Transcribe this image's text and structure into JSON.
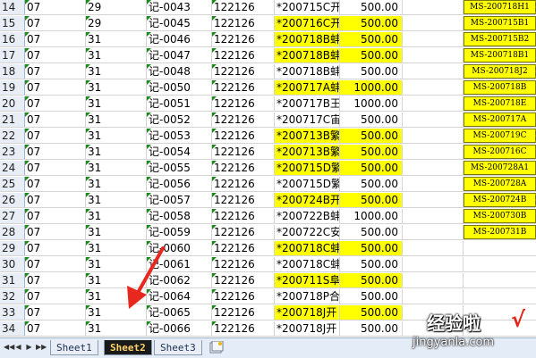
{
  "rows": [
    {
      "n": "14",
      "a": "07",
      "b": "29",
      "c": "记-0043",
      "d": "122126",
      "e": "*200715C开",
      "f": "500.00",
      "hl": false,
      "ms": "MS-200718H1"
    },
    {
      "n": "15",
      "a": "07",
      "b": "29",
      "c": "记-0045",
      "d": "122126",
      "e": "*200716C开",
      "f": "500.00",
      "hl": true,
      "ms": "MS-200715B1"
    },
    {
      "n": "16",
      "a": "07",
      "b": "31",
      "c": "记-0046",
      "d": "122126",
      "e": "*200718B蚌",
      "f": "500.00",
      "hl": true,
      "ms": "MS-200715B2"
    },
    {
      "n": "17",
      "a": "07",
      "b": "31",
      "c": "记-0047",
      "d": "122126",
      "e": "*200718B蚌",
      "f": "500.00",
      "hl": true,
      "ms": "MS-200718B1"
    },
    {
      "n": "18",
      "a": "07",
      "b": "31",
      "c": "记-0048",
      "d": "122126",
      "e": "*200718B蚌",
      "f": "500.00",
      "hl": false,
      "ms": "MS-200718J2"
    },
    {
      "n": "19",
      "a": "07",
      "b": "31",
      "c": "记-0050",
      "d": "122126",
      "e": "*200717A蚌",
      "f": "1000.00",
      "hl": true,
      "ms": "MS-200718B"
    },
    {
      "n": "20",
      "a": "07",
      "b": "31",
      "c": "记-0051",
      "d": "122126",
      "e": "*200717B王",
      "f": "1000.00",
      "hl": false,
      "ms": "MS-200718E"
    },
    {
      "n": "21",
      "a": "07",
      "b": "31",
      "c": "记-0052",
      "d": "122126",
      "e": "*200717C宙",
      "f": "500.00",
      "hl": false,
      "ms": "MS-200717A"
    },
    {
      "n": "22",
      "a": "07",
      "b": "31",
      "c": "记-0053",
      "d": "122126",
      "e": "*200713B繁",
      "f": "500.00",
      "hl": true,
      "ms": "MS-200719C"
    },
    {
      "n": "23",
      "a": "07",
      "b": "31",
      "c": "记-0054",
      "d": "122126",
      "e": "*200713B繁",
      "f": "500.00",
      "hl": true,
      "ms": "MS-200716C"
    },
    {
      "n": "24",
      "a": "07",
      "b": "31",
      "c": "记-0055",
      "d": "122126",
      "e": "*200715D繁",
      "f": "500.00",
      "hl": true,
      "ms": "MS-200728A1"
    },
    {
      "n": "25",
      "a": "07",
      "b": "31",
      "c": "记-0056",
      "d": "122126",
      "e": "*200715D繁",
      "f": "500.00",
      "hl": false,
      "ms": "MS-200728A"
    },
    {
      "n": "26",
      "a": "07",
      "b": "31",
      "c": "记-0057",
      "d": "122126",
      "e": "*200724B开",
      "f": "500.00",
      "hl": true,
      "ms": "MS-200724B"
    },
    {
      "n": "27",
      "a": "07",
      "b": "31",
      "c": "记-0058",
      "d": "122126",
      "e": "*200722B蚌",
      "f": "1000.00",
      "hl": false,
      "ms": "MS-200730B"
    },
    {
      "n": "28",
      "a": "07",
      "b": "31",
      "c": "记-0059",
      "d": "122126",
      "e": "*200722C安",
      "f": "500.00",
      "hl": false,
      "ms": "MS-200731B"
    },
    {
      "n": "29",
      "a": "07",
      "b": "31",
      "c": "记-0060",
      "d": "122126",
      "e": "*200718C蚌",
      "f": "500.00",
      "hl": true,
      "ms": ""
    },
    {
      "n": "30",
      "a": "07",
      "b": "31",
      "c": "记-0061",
      "d": "122126",
      "e": "*200718C蚌",
      "f": "500.00",
      "hl": false,
      "ms": ""
    },
    {
      "n": "31",
      "a": "07",
      "b": "31",
      "c": "记-0062",
      "d": "122126",
      "e": "*200711S阜",
      "f": "500.00",
      "hl": true,
      "ms": ""
    },
    {
      "n": "32",
      "a": "07",
      "b": "31",
      "c": "记-0064",
      "d": "122126",
      "e": "*200718P合",
      "f": "500.00",
      "hl": false,
      "ms": ""
    },
    {
      "n": "33",
      "a": "07",
      "b": "31",
      "c": "记-0065",
      "d": "122126",
      "e": "*200718J开",
      "f": "500.00",
      "hl": true,
      "ms": ""
    },
    {
      "n": "34",
      "a": "07",
      "b": "31",
      "c": "记-0066",
      "d": "122126",
      "e": "*200718J开",
      "f": "500.00",
      "hl": false,
      "ms": ""
    }
  ],
  "tabs": {
    "sheet1": "Sheet1",
    "sheet2": "Sheet2",
    "sheet3": "Sheet3",
    "active": "Sheet2"
  },
  "nav": {
    "first": "◀◀",
    "prev": "◀",
    "next": "▶",
    "last": "▶▶"
  },
  "watermark": {
    "line1": "经验啦",
    "check": "√",
    "line2": "jingyanla.com"
  },
  "colors": {
    "highlight": "#ffff00",
    "arrow": "#e8281e"
  }
}
